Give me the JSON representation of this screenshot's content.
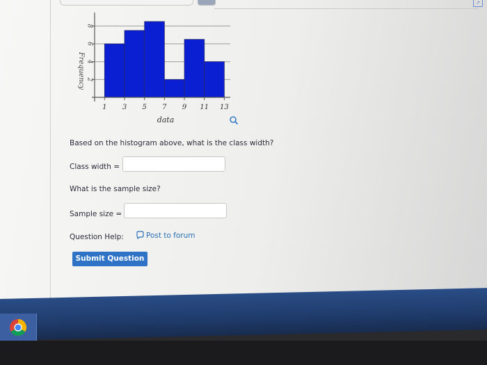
{
  "histogram": {
    "chart_data": {
      "type": "bar",
      "x_tick_labels": [
        "1",
        "3",
        "5",
        "7",
        "9",
        "11",
        "13"
      ],
      "bins": [
        {
          "start": 1,
          "end": 3,
          "frequency": 6
        },
        {
          "start": 3,
          "end": 5,
          "frequency": 7.5
        },
        {
          "start": 5,
          "end": 7,
          "frequency": 8.5
        },
        {
          "start": 7,
          "end": 9,
          "frequency": 2
        },
        {
          "start": 9,
          "end": 11,
          "frequency": 6.5
        },
        {
          "start": 11,
          "end": 13,
          "frequency": 4
        }
      ],
      "y_ticks": [
        "2",
        "4",
        "6",
        "8"
      ],
      "xlabel": "data",
      "ylabel": "Frequency",
      "xlim": [
        0,
        13.6
      ],
      "ylim": [
        0,
        9.2
      ],
      "grid": true,
      "bar_color": "#0a1ed2"
    }
  },
  "question1": {
    "prompt": "Based on the histogram above, what is the class width?",
    "label": "Class width =",
    "value": ""
  },
  "question2": {
    "prompt": "What is the sample size?",
    "label": "Sample size =",
    "value": ""
  },
  "help": {
    "label": "Question Help:",
    "forum_link": "Post to forum"
  },
  "submit": {
    "label": "Submit Question",
    "color": "#2e73c6"
  },
  "taskbar": {
    "pinned_icon": "chrome-icon"
  }
}
